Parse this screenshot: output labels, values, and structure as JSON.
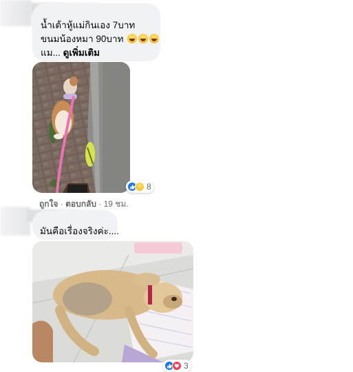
{
  "comment1": {
    "lines": [
      "น้ำเต้าหู้แม่กินเอง 7บาท",
      "ขนมน้องหมา 90บาท"
    ],
    "truncated_prefix": "แม... ",
    "see_more": "ดูเพิ่มเติม",
    "reaction_count": "8",
    "actions": {
      "like": "ถูกใจ",
      "separator": " · ",
      "reply": "ตอบกลับ",
      "time": "19 ชม."
    }
  },
  "comment2": {
    "text": "มันคือเรื่องจริงค่ะ....",
    "reaction_count": "3"
  },
  "colors": {
    "bubble": "#f0f2f5",
    "like_blue": "#1877f2",
    "love_red": "#f33e58",
    "meta_gray": "#65676b"
  },
  "icons": [
    "laughing-emoji",
    "like-icon",
    "haha-icon",
    "love-icon"
  ]
}
